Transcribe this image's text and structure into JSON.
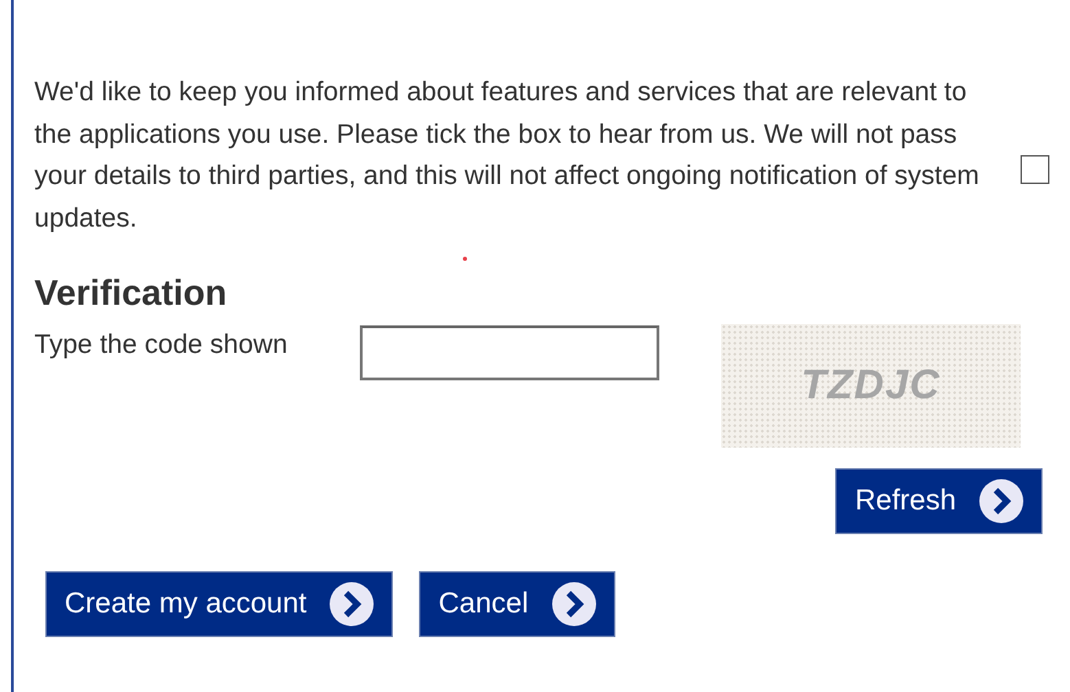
{
  "consent": {
    "text": "We'd like to keep you informed about features and services that are relevant to the applications you use. Please tick the box to hear from us. We will not pass your details to third parties, and this will not affect ongoing notification of system updates.",
    "checked": false
  },
  "verification": {
    "heading": "Verification",
    "label": "Type the code shown",
    "captcha_code": "TZDJC",
    "refresh_button": "Refresh"
  },
  "buttons": [
    {
      "label": "Create my account"
    },
    {
      "label": "Cancel"
    }
  ]
}
